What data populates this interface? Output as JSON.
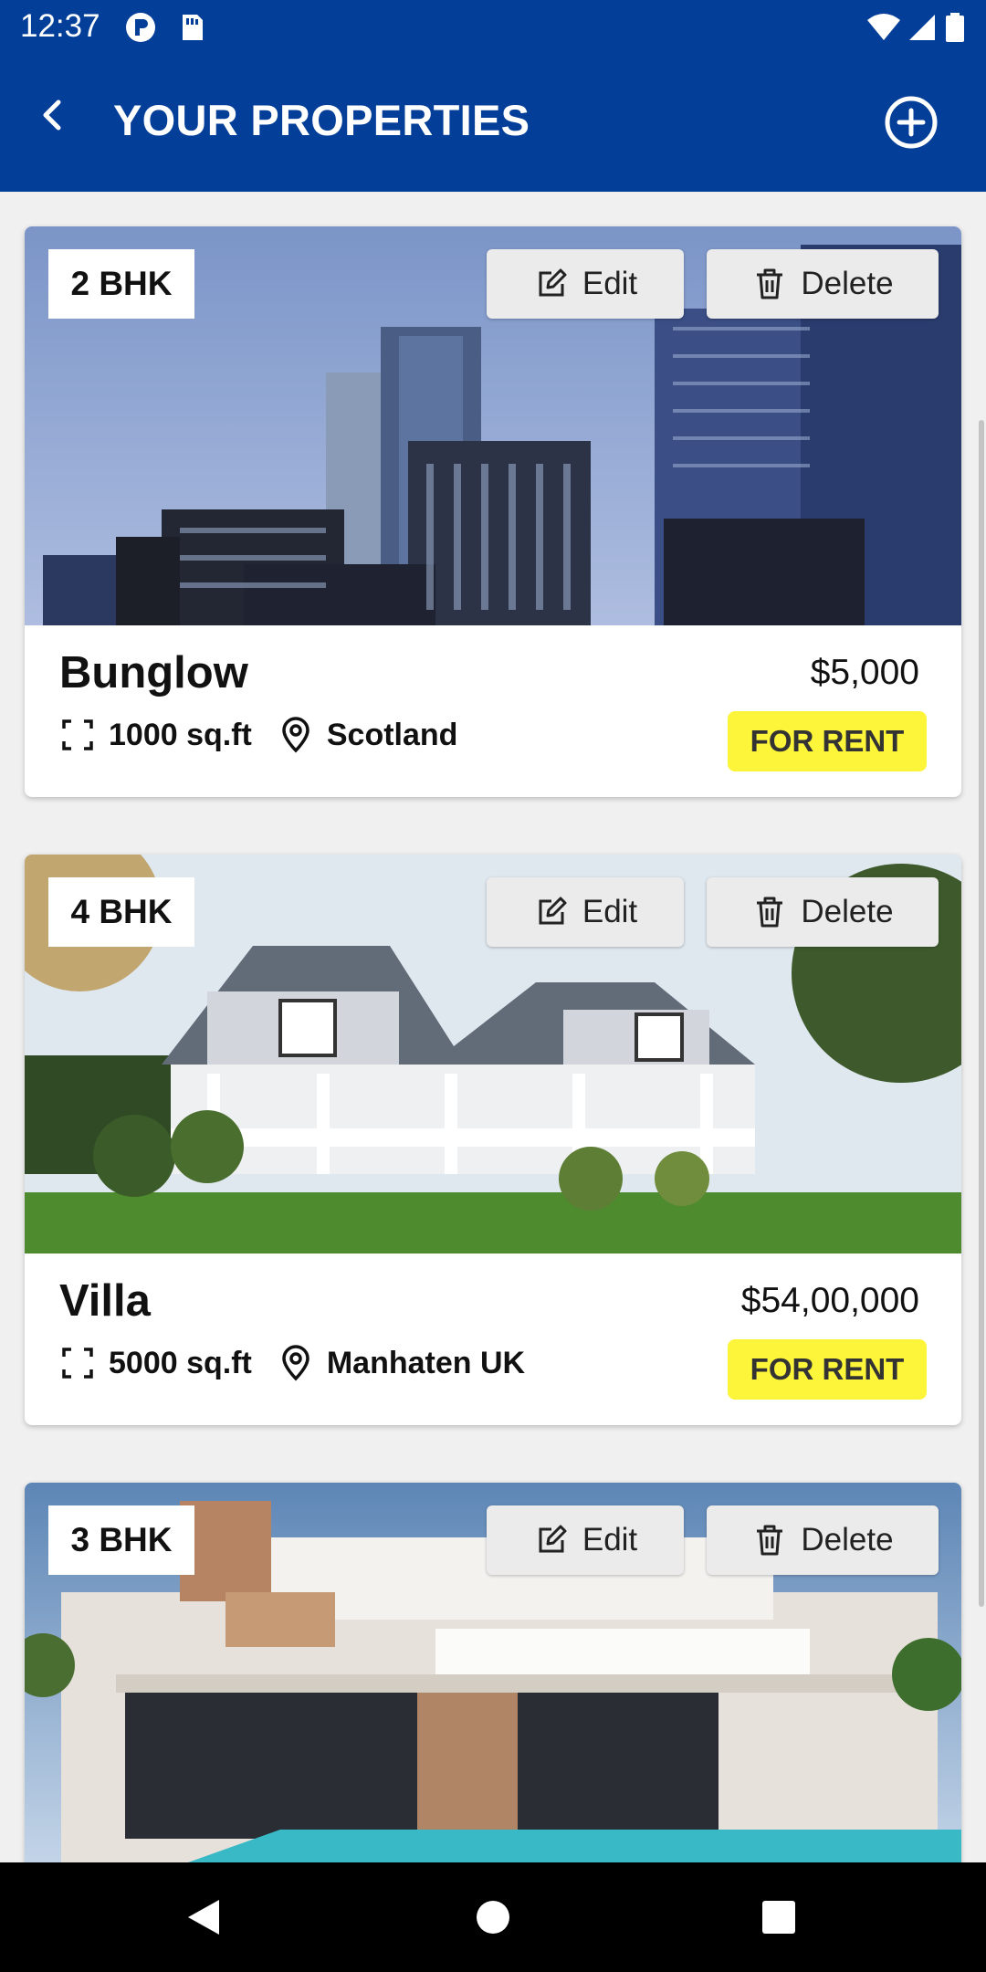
{
  "status_bar": {
    "time": "12:37"
  },
  "app_bar": {
    "title": "YOUR PROPERTIES"
  },
  "properties": [
    {
      "bhk": "2 BHK",
      "edit_label": "Edit",
      "delete_label": "Delete",
      "name": "Bunglow",
      "price": "$5,000",
      "area": "1000 sq.ft",
      "location": "Scotland",
      "status": "FOR RENT",
      "image": "city-skyscrapers"
    },
    {
      "bhk": "4 BHK",
      "edit_label": "Edit",
      "delete_label": "Delete",
      "name": "Villa",
      "price": "$54,00,000",
      "area": "5000 sq.ft",
      "location": "Manhaten UK",
      "status": "FOR RENT",
      "image": "white-villa-house"
    },
    {
      "bhk": "3 BHK",
      "edit_label": "Edit",
      "delete_label": "Delete",
      "name": "",
      "price": "",
      "area": "",
      "location": "",
      "status": "",
      "image": "modern-house-with-pool"
    }
  ],
  "colors": {
    "primary": "#033e99",
    "status_badge": "#fdf53a",
    "background": "#f0f0f0"
  },
  "icons": [
    "back-arrow-icon",
    "add-circle-icon",
    "edit-icon",
    "delete-icon",
    "area-icon",
    "location-pin-icon"
  ]
}
